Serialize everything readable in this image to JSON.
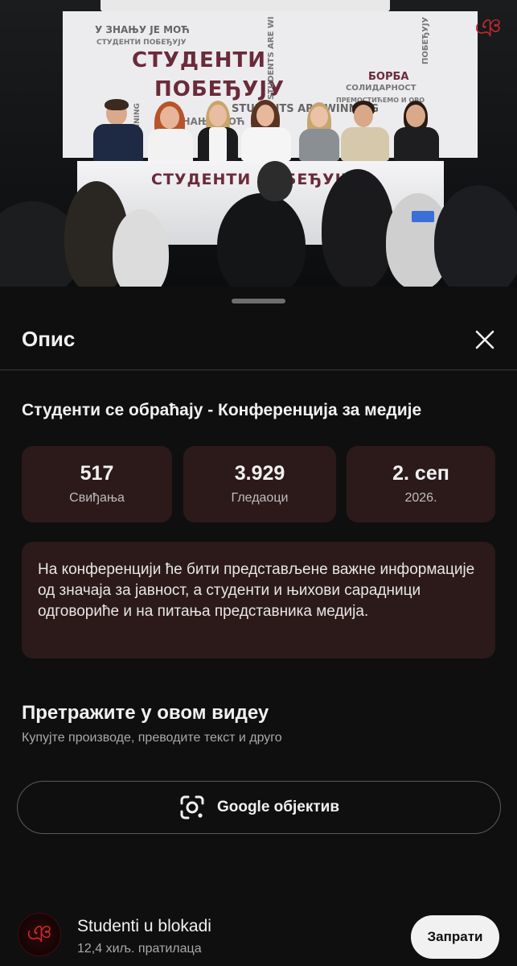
{
  "video": {
    "banner_lines": [
      "У ЗНАЊУ ЈЕ МОЋ",
      "СТУДЕНТИ ПОБЕЂУЈУ",
      "СТУДЕНТИ",
      "ПОБЕЂУЈУ",
      "STUDENTS ARE WINNING",
      "БОРБА",
      "СОЛИДАРНОСТ",
      "ПРЕМОСТИЋЕМО И ОВО",
      "ЗНАЊЕ МОЋ"
    ],
    "banner_vertical": [
      "STUDENTS ARE WI",
      "ПОБЕЂУЈУ",
      "E WINNING"
    ],
    "table_label": "СТУДЕНТИ ПОБЕЂУЈУ",
    "logo_glyph": "ঞ"
  },
  "sheet": {
    "title": "Опис",
    "close_icon": "close-icon",
    "video_title": "Студенти се обраћају - Конференција за медије",
    "stats": [
      {
        "value": "517",
        "label": "Свиђања"
      },
      {
        "value": "3.929",
        "label": "Гледаоци"
      },
      {
        "value": "2. сеп",
        "label": "2026."
      }
    ],
    "description": "На конференцији ће бити представљене важне информације од значаја за јавност, а студенти и њихови сарадници одговориће и на питања представника медија.",
    "search": {
      "title": "Претражите у овом видеу",
      "subtitle": "Купујте производе, преводите текст и друго",
      "lens_label": "Google објектив",
      "lens_icon": "google-lens-icon"
    },
    "channel": {
      "name": "Studenti u blokadi",
      "subscribers": "12,4 хиљ. пратилаца",
      "follow_label": "Запрати",
      "avatar_glyph": "ঞ"
    }
  },
  "colors": {
    "background": "#0f0f0f",
    "card": "#2c1a1a",
    "text": "#f1f1f1",
    "secondary_text": "#a9a9a9",
    "brand_maroon": "#6b2a3a"
  }
}
